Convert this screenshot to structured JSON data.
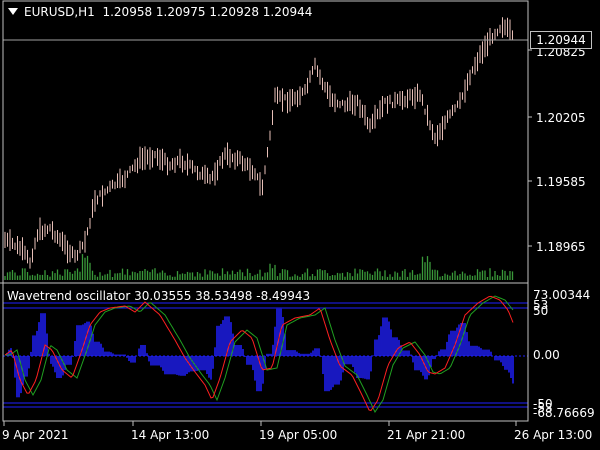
{
  "main_panel": {
    "symbol_label": "EURUSD,H1",
    "ohlc": "1.20958 1.20975 1.20928 1.20944",
    "current_price": "1.20944",
    "price_levels": [
      "1.20825",
      "1.20205",
      "1.19585",
      "1.18965"
    ]
  },
  "oscillator_panel": {
    "title": "Wavetrend oscillator",
    "values": "30.03555 38.53498 -8.49943",
    "scale_labels": {
      "max": "73.00344",
      "upper_a": "53",
      "upper_b": "50",
      "zero": "0.00",
      "lower_a": "-50",
      "lower_b": "-53",
      "min": "-68.76669"
    }
  },
  "time_axis": [
    "9 Apr 2021",
    "14 Apr 13:00",
    "19 Apr 05:00",
    "21 Apr 21:00",
    "26 Apr 13:00"
  ],
  "colors": {
    "background": "#000000",
    "candle": "#e8c0b8",
    "volume": "#3a9a3a",
    "wt1": "#ff2020",
    "wt2": "#20a020",
    "histogram": "#2020ff",
    "level_lines": "#2020ff"
  }
}
